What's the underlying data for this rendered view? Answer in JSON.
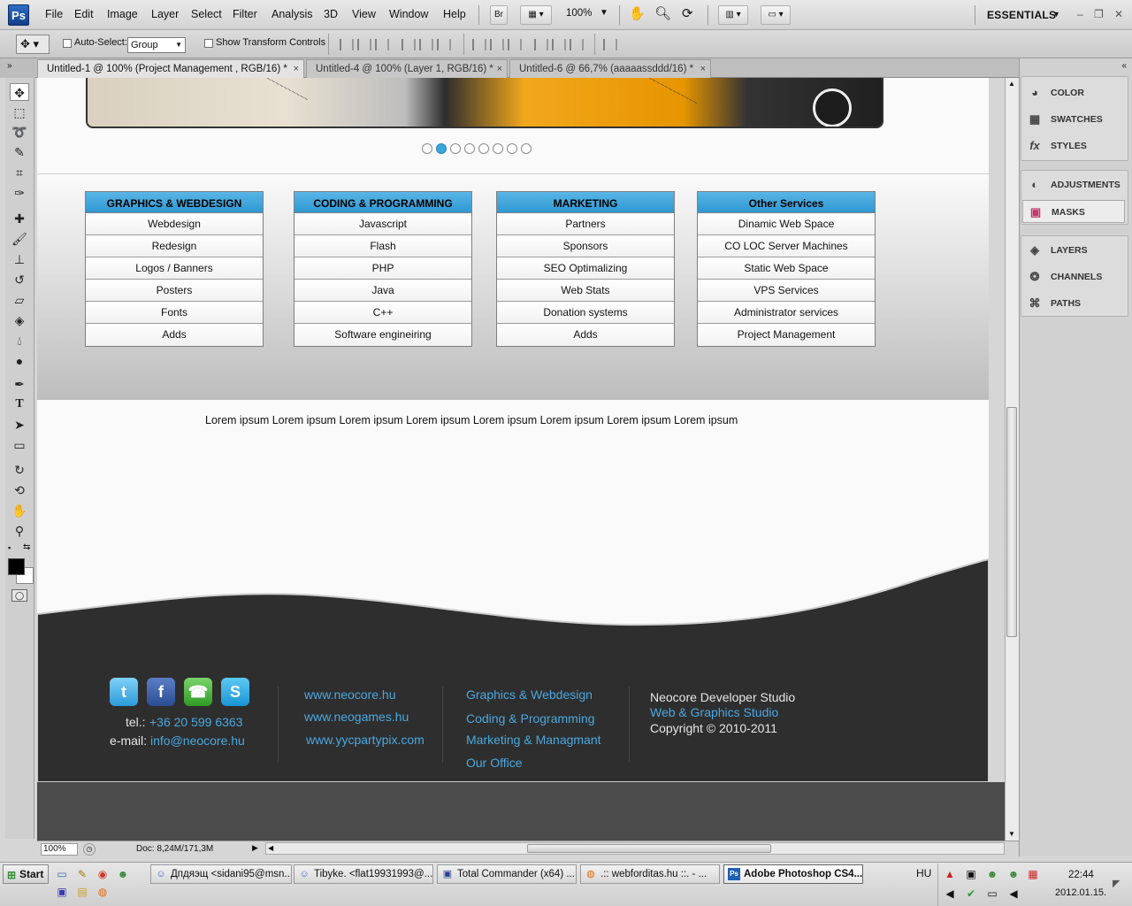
{
  "app": {
    "logo": "Ps",
    "menu": [
      "File",
      "Edit",
      "Image",
      "Layer",
      "Select",
      "Filter",
      "Analysis",
      "3D",
      "View",
      "Window",
      "Help"
    ],
    "bridge_label": "Br",
    "zoom_display": "100%",
    "workspace": "ESSENTIALS"
  },
  "options": {
    "auto_select_label": "Auto-Select:",
    "group_value": "Group",
    "transform_label": "Show Transform Controls"
  },
  "tabs": [
    {
      "label": "Untitled-1 @ 100% (Project Management , RGB/16) *",
      "close": "×",
      "active": true
    },
    {
      "label": "Untitled-4 @ 100% (Layer 1, RGB/16) *",
      "close": "×",
      "active": false
    },
    {
      "label": "Untitled-6 @ 66,7% (aaaaassddd/16) *",
      "close": "×",
      "active": false
    }
  ],
  "tools": [
    "move-icon",
    "marquee-icon",
    "lasso-icon",
    "quick-select-icon",
    "crop-icon",
    "eyedropper-icon",
    "healing-icon",
    "brush-icon",
    "stamp-icon",
    "history-brush-icon",
    "eraser-icon",
    "bucket-icon",
    "blur-icon",
    "dodge-icon",
    "pen-icon",
    "type-icon",
    "path-select-icon",
    "shape-icon",
    "3d-rotate-icon",
    "3d-orbit-icon",
    "hand-icon",
    "zoom-icon"
  ],
  "status": {
    "zoom": "100%",
    "doc": "Doc: 8,24M/171,3M"
  },
  "panels": {
    "group1": [
      "COLOR",
      "SWATCHES",
      "STYLES"
    ],
    "group2": [
      "ADJUSTMENTS",
      "MASKS"
    ],
    "group3": [
      "LAYERS",
      "CHANNELS",
      "PATHS"
    ]
  },
  "page": {
    "slider_dots": 8,
    "slider_active": 2,
    "services": [
      {
        "title": "GRAPHICS & WEBDESIGN",
        "items": [
          "Webdesign",
          "Redesign",
          "Logos / Banners",
          "Posters",
          "Fonts",
          "Adds"
        ]
      },
      {
        "title": "CODING & PROGRAMMING",
        "items": [
          "Javascript",
          "Flash",
          "PHP",
          "Java",
          "C++",
          "Software engineiring"
        ]
      },
      {
        "title": "MARKETING",
        "items": [
          "Partners",
          "Sponsors",
          "SEO Optimalizing",
          "Web Stats",
          "Donation systems",
          "Adds"
        ]
      },
      {
        "title": "Other Services",
        "items": [
          "Dinamic Web Space",
          "CO LOC Server Machines",
          "Static Web Space",
          "VPS Services",
          "Administrator services",
          "Project Management"
        ]
      }
    ],
    "lorem": "Lorem ipsum Lorem ipsum Lorem ipsum Lorem ipsum Lorem ipsum Lorem ipsum Lorem ipsum Lorem ipsum",
    "footer": {
      "tel_label": "tel.:",
      "tel": "+36 20 599 6363",
      "email_label": "e-mail:",
      "email": "info@neocore.hu",
      "sites": [
        "www.neocore.hu",
        "www.neogames.hu",
        "www.yycpartypix.com"
      ],
      "services": [
        "Graphics & Webdesign",
        "Coding & Programming",
        "Marketing & Managmant",
        "Our Office"
      ],
      "studio": "Neocore Developer Studio",
      "tagline": "Web & Graphics Studio",
      "copyright": "Copyright © 2010-2011"
    }
  },
  "taskbar": {
    "start": "Start",
    "buttons": [
      {
        "label": "Дпдяэщ <sidani95@msn...",
        "active": false
      },
      {
        "label": "Tibyke. <flat19931993@...",
        "active": false
      },
      {
        "label": "Total Commander (x64) ...",
        "active": false
      },
      {
        "label": ".:: webforditas.hu ::. - ...",
        "active": false
      },
      {
        "label": "Adobe Photoshop CS4...",
        "active": true
      }
    ],
    "lang": "HU",
    "time": "22:44",
    "date": "2012.01.15."
  }
}
